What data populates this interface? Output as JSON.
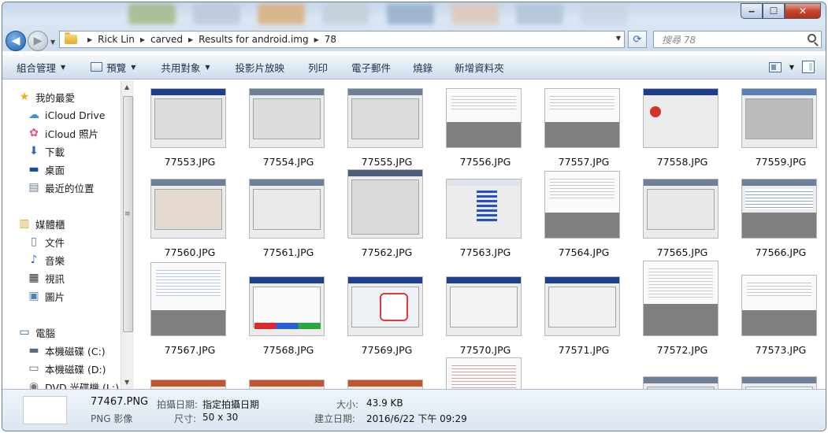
{
  "window": {
    "caption_min": "‒",
    "caption_max": "☐",
    "caption_close": "✕"
  },
  "address": {
    "crumbs": [
      "Rick Lin",
      "carved",
      "Results for android.img",
      "78"
    ]
  },
  "search": {
    "placeholder": "搜尋 78"
  },
  "toolbar": {
    "organize": "組合管理",
    "preview": "預覽",
    "share": "共用對象",
    "slideshow": "投影片放映",
    "print": "列印",
    "email": "電子郵件",
    "burn": "燒錄",
    "new_folder": "新增資料夾"
  },
  "sidebar": {
    "favorites": "我的最愛",
    "icloud_drive": "iCloud Drive",
    "icloud_photos": "iCloud 照片",
    "downloads": "下載",
    "desktop": "桌面",
    "recent": "最近的位置",
    "libraries": "媒體櫃",
    "documents": "文件",
    "music": "音樂",
    "videos": "視訊",
    "pictures": "圖片",
    "computer": "電腦",
    "drive_c": "本機磁碟 (C:)",
    "drive_d": "本機磁碟 (D:)",
    "dvd": "DVD 光碟機 (L:)"
  },
  "files": [
    {
      "name": "77553.JPG"
    },
    {
      "name": "77554.JPG"
    },
    {
      "name": "77555.JPG"
    },
    {
      "name": "77556.JPG"
    },
    {
      "name": "77557.JPG"
    },
    {
      "name": "77558.JPG"
    },
    {
      "name": "77559.JPG"
    },
    {
      "name": "77560.JPG"
    },
    {
      "name": "77561.JPG"
    },
    {
      "name": "77562.JPG"
    },
    {
      "name": "77563.JPG"
    },
    {
      "name": "77564.JPG"
    },
    {
      "name": "77565.JPG"
    },
    {
      "name": "77566.JPG"
    },
    {
      "name": "77567.JPG"
    },
    {
      "name": "77568.JPG"
    },
    {
      "name": "77569.JPG"
    },
    {
      "name": "77570.JPG"
    },
    {
      "name": "77571.JPG"
    },
    {
      "name": "77572.JPG"
    },
    {
      "name": "77573.JPG"
    }
  ],
  "details": {
    "name": "77467.PNG",
    "type": "PNG 影像",
    "date_taken_label": "拍攝日期:",
    "date_taken_value": "指定拍攝日期",
    "dimensions_label": "尺寸:",
    "dimensions_value": "50 x 30",
    "size_label": "大小:",
    "size_value": "43.9 KB",
    "created_label": "建立日期:",
    "created_value": "2016/6/22 下午 09:29"
  }
}
